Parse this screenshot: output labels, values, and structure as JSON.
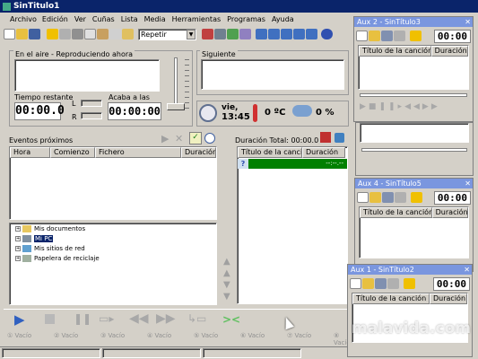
{
  "window": {
    "title": "SinTitulo1"
  },
  "menu": [
    "Archivo",
    "Edición",
    "Ver",
    "Cuñas",
    "Lista",
    "Media",
    "Herramientas",
    "Programas",
    "Ayuda"
  ],
  "toolbar": {
    "mode_select": "Repetir"
  },
  "on_air": {
    "label": "En el aire - Reproduciendo ahora",
    "remaining_label": "Tiempo restante",
    "remaining_value": "00:00.0",
    "ends_label": "Acaba a las",
    "ends_value": "00:00:00",
    "channel_l": "L",
    "channel_r": "R"
  },
  "next": {
    "label": "Siguiente"
  },
  "status": {
    "day": "vie,",
    "time": "13:45",
    "temperature": "0 ºC",
    "rain": "0 %"
  },
  "events": {
    "label": "Eventos próximos",
    "columns": [
      "Hora",
      "Comienzo",
      "Fichero",
      "Duración"
    ]
  },
  "tree": [
    "Mis documentos",
    "Mi PC",
    "Mis sitios de red",
    "Papelera de reciclaje"
  ],
  "playlist": {
    "total": "Duración Total: 00:00.0",
    "columns": [
      "Título de la canción",
      "Duración"
    ],
    "row_duration": "--:--.--"
  },
  "slots": [
    "Vacío",
    "Vacío",
    "Vacío",
    "Vacío",
    "Vacío",
    "Vacío",
    "Vacío",
    "Vacío"
  ],
  "aux_windows": [
    {
      "title": "Aux 2 - SinTítulo3",
      "time": "00:00",
      "columns": [
        "Título de la canción",
        "Duración"
      ]
    },
    {
      "title": "Aux 4 - SinTítulo5",
      "time": "00:00",
      "columns": [
        "Título de la canción",
        "Duración"
      ]
    },
    {
      "title": "Aux 1 - SinTítulo2",
      "time": "00:00",
      "columns": [
        "Título de la canción",
        "Duración"
      ]
    }
  ],
  "watermark": "malavida.com",
  "colors": {
    "title_active": "#0a246a",
    "title_inactive": "#7a96df",
    "playlist_row": "#008000"
  }
}
